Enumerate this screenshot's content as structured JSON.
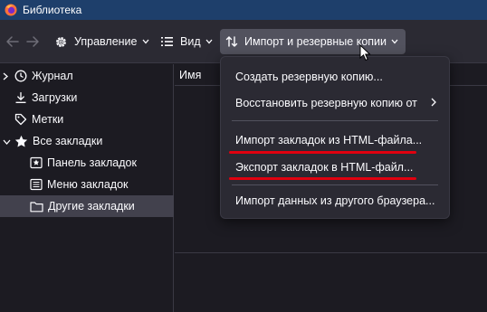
{
  "window": {
    "title": "Библиотека"
  },
  "toolbar": {
    "manage_label": "Управление",
    "view_label": "Вид",
    "import_backup_label": "Импорт и резервные копии"
  },
  "sidebar": {
    "items": [
      {
        "label": "Журнал",
        "icon": "clock-icon"
      },
      {
        "label": "Загрузки",
        "icon": "download-icon"
      },
      {
        "label": "Метки",
        "icon": "tag-icon"
      },
      {
        "label": "Все закладки",
        "icon": "star-icon"
      },
      {
        "label": "Панель закладок",
        "icon": "bookmark-toolbar-icon"
      },
      {
        "label": "Меню закладок",
        "icon": "bookmark-menu-icon"
      },
      {
        "label": "Другие закладки",
        "icon": "folder-icon",
        "selected": true
      }
    ]
  },
  "content": {
    "column_name": "Имя"
  },
  "menu": {
    "items": [
      {
        "label": "Создать резервную копию..."
      },
      {
        "label": "Восстановить резервную копию от",
        "submenu": true
      },
      {
        "label": "Импорт закладок из HTML-файла..."
      },
      {
        "label": "Экспорт закладок в HTML-файл..."
      },
      {
        "label": "Импорт данных из другого браузера..."
      }
    ]
  },
  "colors": {
    "titlebar": "#1e3f6b",
    "toolbar": "#2b2a33",
    "background": "#1c1b22",
    "selected_item": "#42414d",
    "annotation_red": "#e0000f"
  }
}
